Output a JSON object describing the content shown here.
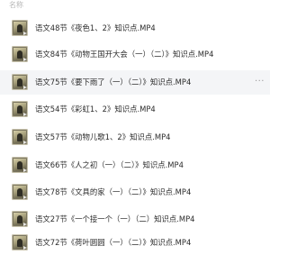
{
  "header": {
    "name_column": "名称"
  },
  "list": {
    "more_glyph": "···",
    "files": [
      {
        "name": "语文48节《夜色1、2》知识点.MP4",
        "icon": "video-thumbnail-icon"
      },
      {
        "name": "语文84节《动物王国开大会（一）（二）》知识点.MP4",
        "icon": "video-thumbnail-icon"
      },
      {
        "name": "语文75节《要下雨了（一）（二）》知识点.MP4",
        "icon": "video-thumbnail-icon"
      },
      {
        "name": "语文54节《彩虹1、2》知识点.MP4",
        "icon": "video-thumbnail-icon"
      },
      {
        "name": "语文57节《动物儿歌1、2》知识点.MP4",
        "icon": "video-thumbnail-icon"
      },
      {
        "name": "语文66节《人之初（一）（二）》知识点.MP4",
        "icon": "video-thumbnail-icon"
      },
      {
        "name": "语文78节《文具的家（一）（二）》知识点.MP4",
        "icon": "video-thumbnail-icon"
      },
      {
        "name": "语文27节《一个接一个（一）（二）知识点.MP4",
        "icon": "video-thumbnail-icon"
      },
      {
        "name": "语文72节《荷叶圆圆（一）（二）》知识点.MP4",
        "icon": "video-thumbnail-icon"
      }
    ]
  }
}
